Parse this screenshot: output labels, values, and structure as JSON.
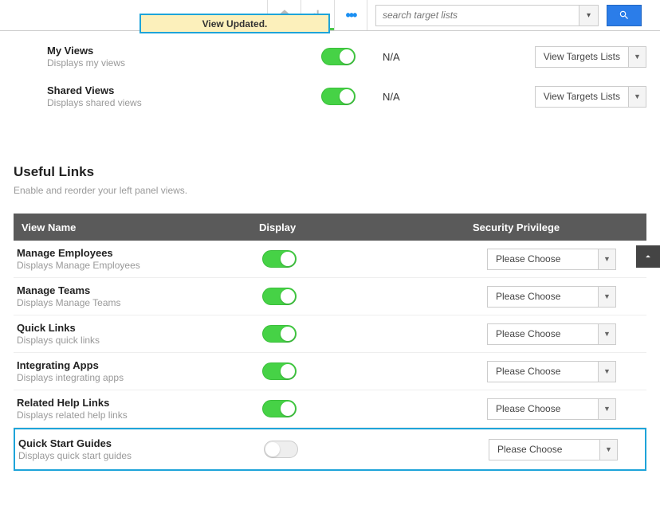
{
  "topbar": {
    "notification": "View Updated.",
    "search": {
      "placeholder": "search target lists"
    }
  },
  "views": {
    "rows": [
      {
        "title": "My Views",
        "desc": "Displays my views",
        "na": "N/A",
        "dd_label": "View Targets Lists"
      },
      {
        "title": "Shared Views",
        "desc": "Displays shared views",
        "na": "N/A",
        "dd_label": "View Targets Lists"
      }
    ]
  },
  "useful": {
    "title": "Useful Links",
    "desc": "Enable and reorder your left panel views.",
    "headers": {
      "col1": "View Name",
      "col2": "Display",
      "col3": "Security Privilege"
    },
    "rows": [
      {
        "title": "Manage Employees",
        "desc": "Displays Manage Employees",
        "on": true,
        "dd": "Please Choose"
      },
      {
        "title": "Manage Teams",
        "desc": "Displays Manage Teams",
        "on": true,
        "dd": "Please Choose"
      },
      {
        "title": "Quick Links",
        "desc": "Displays quick links",
        "on": true,
        "dd": "Please Choose"
      },
      {
        "title": "Integrating Apps",
        "desc": "Displays integrating apps",
        "on": true,
        "dd": "Please Choose"
      },
      {
        "title": "Related Help Links",
        "desc": "Displays related help links",
        "on": true,
        "dd": "Please Choose"
      },
      {
        "title": "Quick Start Guides",
        "desc": "Displays quick start guides",
        "on": false,
        "dd": "Please Choose"
      }
    ]
  }
}
